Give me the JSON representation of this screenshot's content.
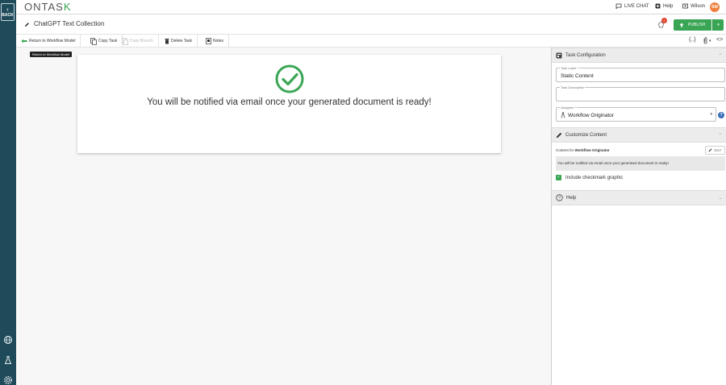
{
  "app": {
    "logo_main": "ONTAS",
    "logo_accent": "K"
  },
  "rail": {
    "back_label": "BACK"
  },
  "topbar": {
    "live_chat": "LIVE CHAT",
    "help": "Help",
    "user": "Wilson",
    "avatar_initials": "SW"
  },
  "titlebar": {
    "title": "ChatGPT Text Collection",
    "notification_count": "2",
    "publish_label": "PUBLISH"
  },
  "toolbar": {
    "return_label": "Return to Workflow Model",
    "copy_task_label": "Copy Task",
    "copy_branch_label": "Copy Branch",
    "delete_task_label": "Delete Task",
    "notes_label": "Notes",
    "code_braces": "{..}",
    "code_tags": "<>"
  },
  "tooltip": {
    "text": "Return to Workflow Model"
  },
  "canvas": {
    "message": "You will be notified via email once your generated document is ready!"
  },
  "panel": {
    "task_config": {
      "title": "Task Configuration",
      "task_label_label": "Task Label *",
      "task_label_value": "Static Content",
      "task_description_label": "Task Description",
      "task_description_value": "",
      "assignee_label": "Assignee *",
      "assignee_value": "Workflow Originator"
    },
    "customize": {
      "title": "Customize Content",
      "content_for_prefix": "Content for",
      "content_for_target": "Workflow Originator",
      "edit_label": "EDIT",
      "content_text": "You will be notified via email once your generated document is ready!",
      "checkbox_label": "Include checkmark graphic",
      "checkbox_checked": true
    },
    "help": {
      "title": "Help"
    }
  },
  "colors": {
    "rail": "#1e4a5a",
    "accent_green": "#3aa655",
    "avatar": "#f07f3c",
    "badge": "#e2402b",
    "help_blue": "#3b6fb6"
  }
}
